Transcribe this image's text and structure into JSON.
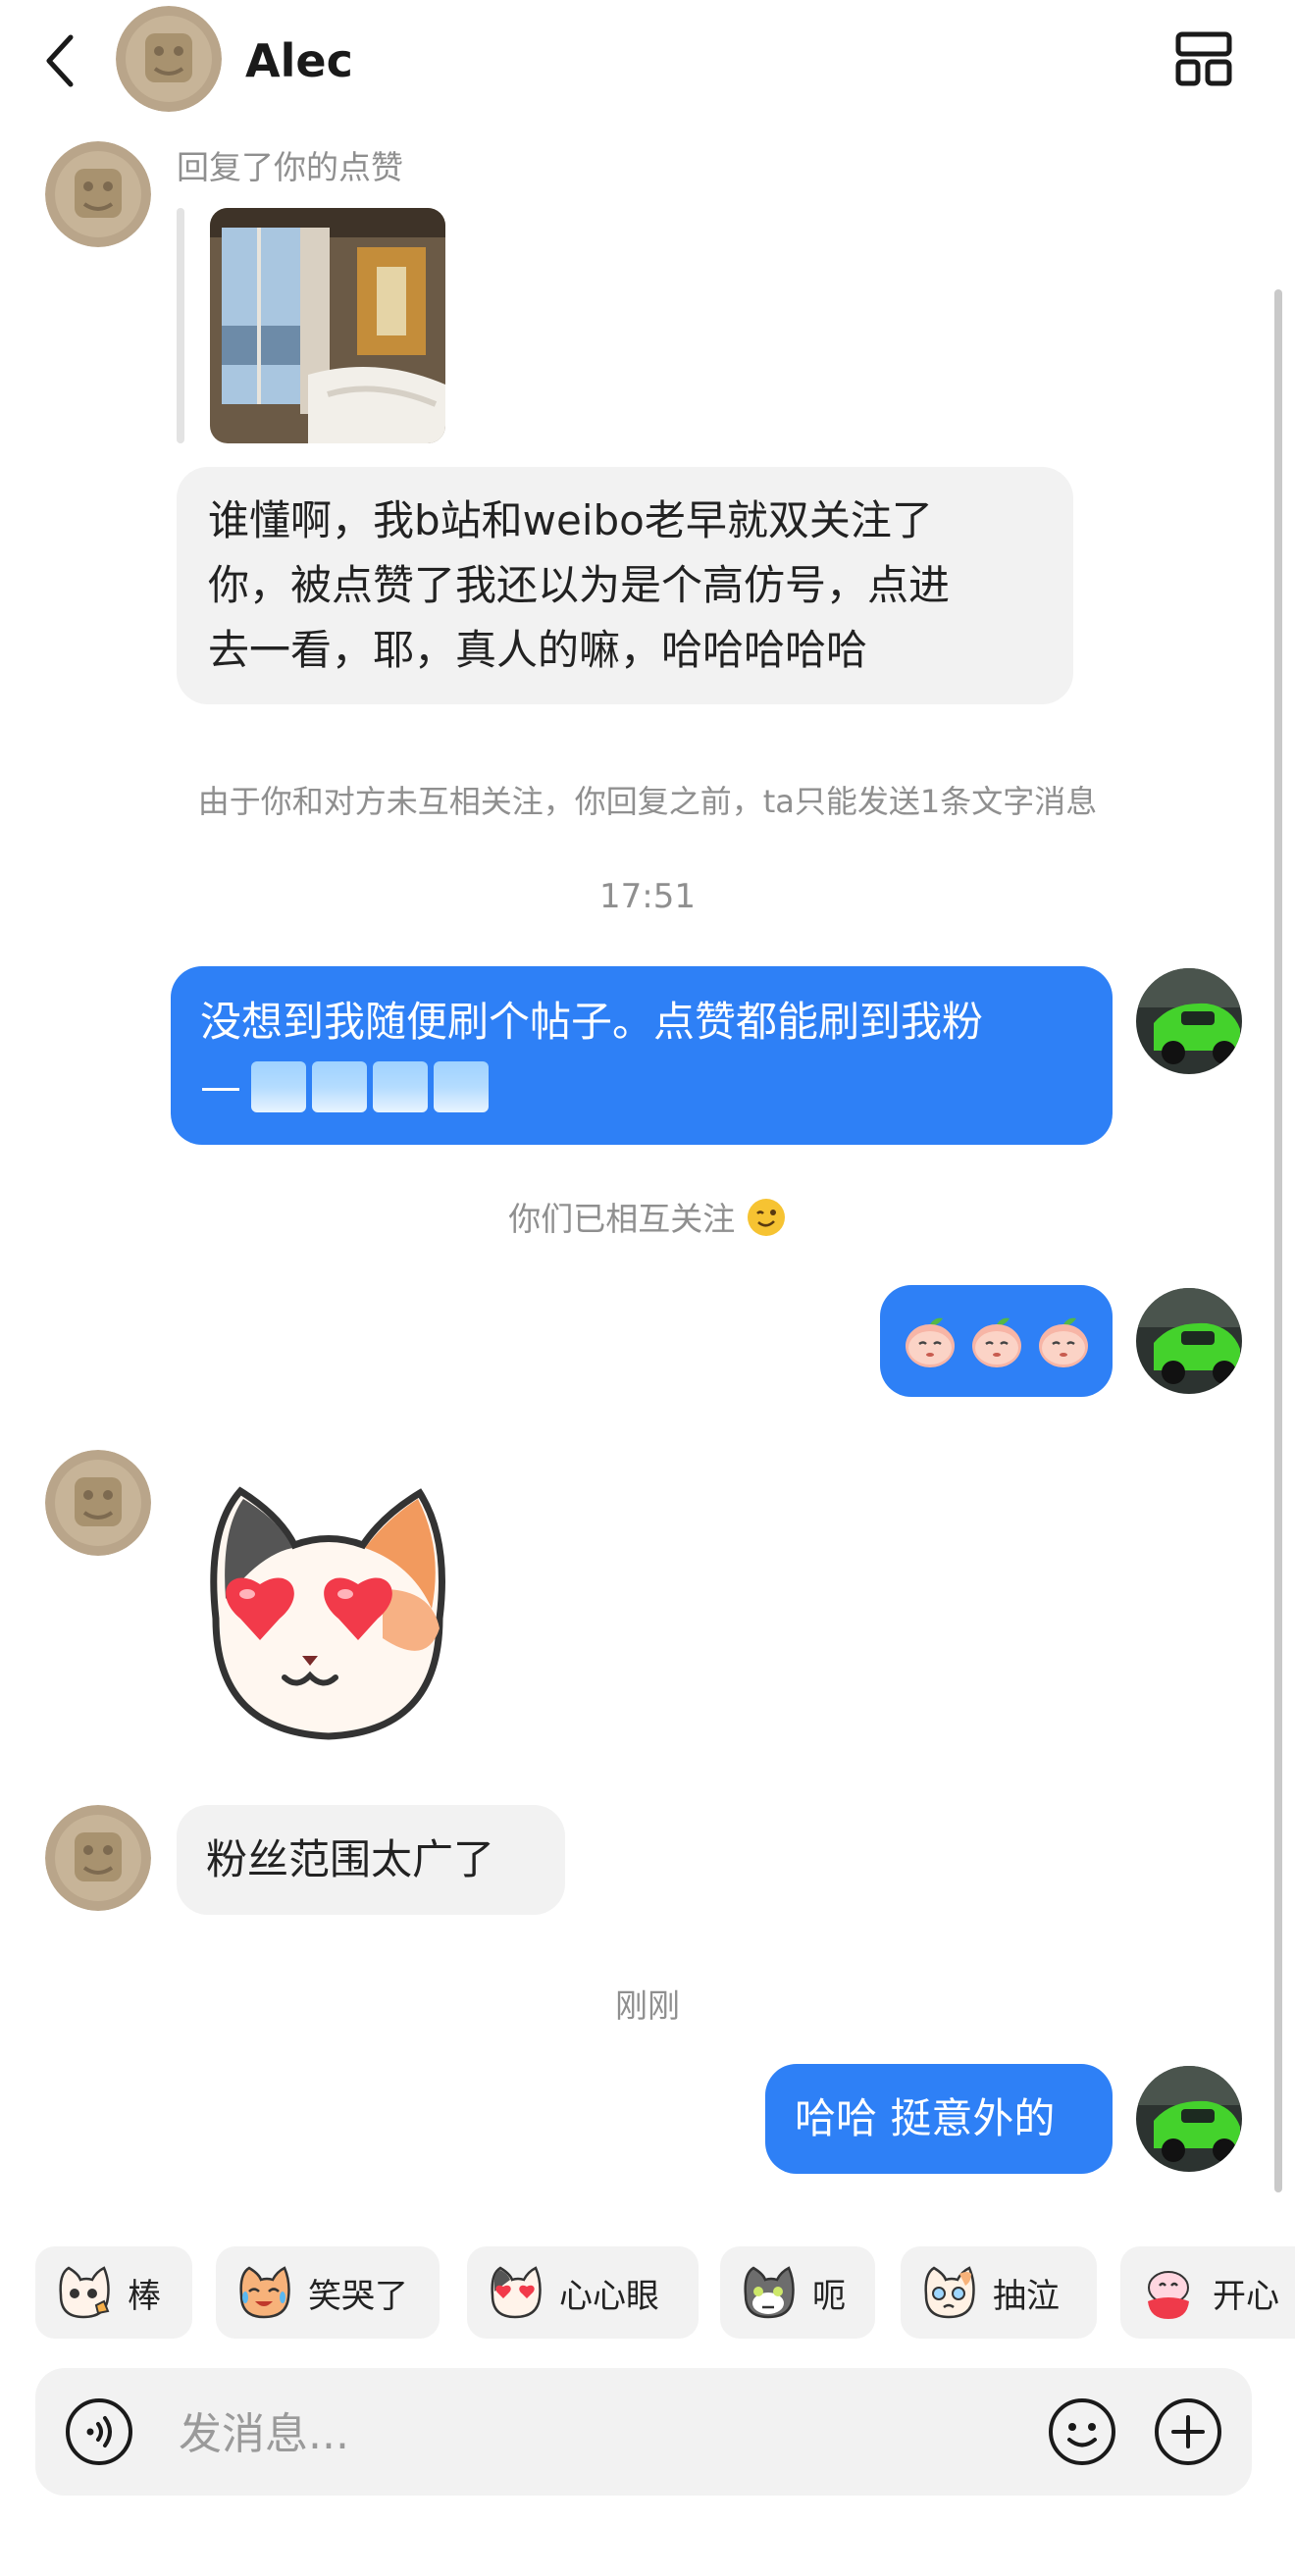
{
  "header": {
    "contact_name": "Alec"
  },
  "messages": {
    "reply_note": "回复了你的点赞",
    "m1": "谁懂啊，我b站和weibo老早就双关注了你，被点赞了我还以为是个高仿号，点进去一看，耶，真人的嘛，哈哈哈哈哈",
    "m1_lines": [
      "谁懂啊，我b站和weibo老早就双关注了",
      "你，被点赞了我还以为是个高仿号，点进",
      "去一看，耶，真人的嘛，哈哈哈哈哈"
    ],
    "system_limit": "由于你和对方未互相关注，你回复之前，ta只能发送1条文字消息",
    "time_1": "17:51",
    "m2_line1": "没想到我随便刷个帖子。点赞都能刷到我粉",
    "m2_line2": "—",
    "system_follow": "你们已相互关注",
    "m5": "粉丝范围太广了",
    "time_2": "刚刚",
    "m6": "哈哈 挺意外的"
  },
  "quick_reactions": [
    "棒",
    "笑哭了",
    "心心眼",
    "呃",
    "抽泣",
    "开心"
  ],
  "composer": {
    "placeholder": "发消息..."
  },
  "colors": {
    "accent": "#2e80f6",
    "incoming_bubble": "#f2f2f2",
    "system_text": "#8f8f8f"
  }
}
